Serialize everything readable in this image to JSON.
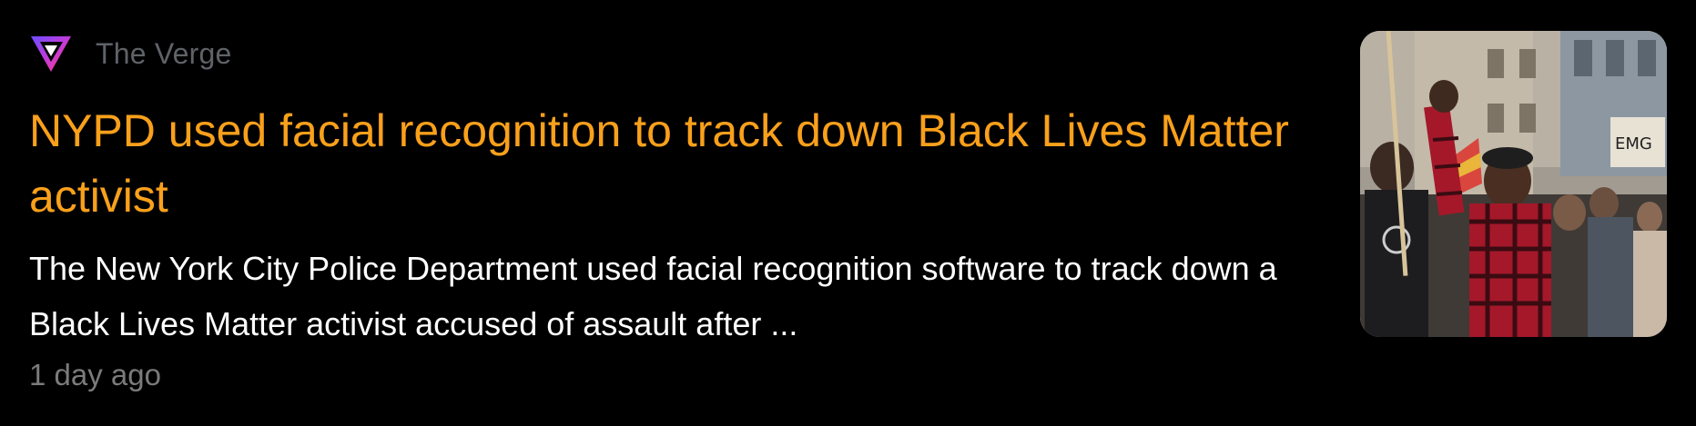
{
  "article": {
    "source": "The Verge",
    "source_logo": "the-verge-logo",
    "headline": "NYPD used facial recognition to track down Black Lives Matter activist",
    "snippet": "The New York City Police Department used facial recognition software to track down a Black Lives Matter activist accused of assault after ...",
    "timestamp": "1 day ago",
    "thumbnail": "protest-photo"
  },
  "colors": {
    "background": "#000000",
    "headline": "#f9a01b",
    "source": "#5f6368",
    "snippet": "#ffffff",
    "timestamp": "#7b7b7b"
  }
}
